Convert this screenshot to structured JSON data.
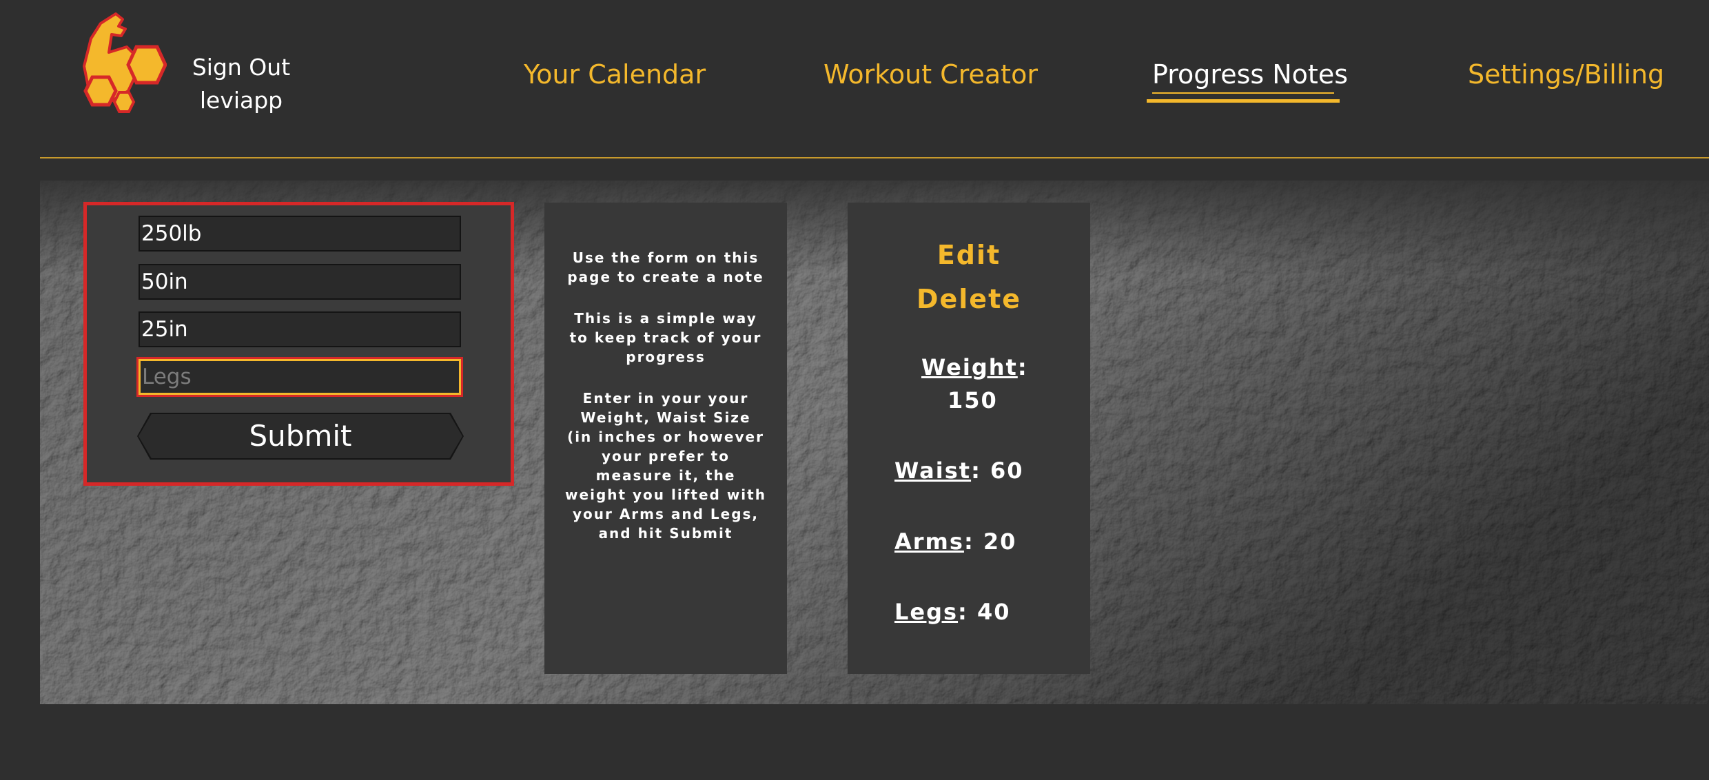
{
  "header": {
    "sign_out_label": "Sign Out",
    "username": "leviapp",
    "logo_icon": "flexed-arm-hexagon-logo-icon",
    "nav": [
      {
        "label": "Your Calendar",
        "active": false
      },
      {
        "label": "Workout Creator",
        "active": false
      },
      {
        "label": "Progress Notes",
        "active": true
      },
      {
        "label": "Settings/Billing",
        "active": false
      }
    ]
  },
  "form": {
    "weight_value": "250lb",
    "waist_value": "50in",
    "arms_value": "25in",
    "legs_value": "",
    "legs_placeholder": "Legs",
    "submit_label": "Submit"
  },
  "instructions": {
    "p1": "Use the form on this page to create a note",
    "p2": "This is a simple way to keep track of your progress",
    "p3": "Enter in your your Weight, Waist Size (in inches or however your prefer to measure it, the weight you lifted with your Arms and Legs, and hit Submit"
  },
  "note": {
    "edit_label": "Edit",
    "delete_label": "Delete",
    "weight_key": "Weight",
    "weight_value": "150",
    "waist_key": "Waist",
    "waist_value": "60",
    "arms_key": "Arms",
    "arms_value": "20",
    "legs_key": "Legs",
    "legs_value": "40",
    "separator": ": "
  },
  "colors": {
    "accent": "#f4b82c",
    "focus_border": "#d62828",
    "background": "#2f2f2f",
    "panel": "#383838"
  }
}
